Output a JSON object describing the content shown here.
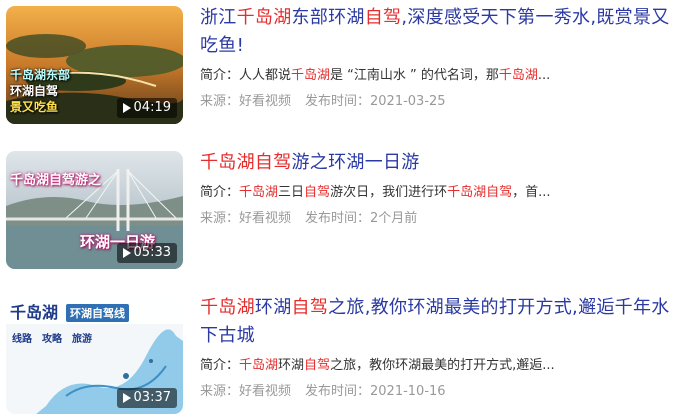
{
  "results": [
    {
      "title_parts": [
        {
          "text": "浙江",
          "hl": false
        },
        {
          "text": "千岛湖",
          "hl": true
        },
        {
          "text": "东部环湖",
          "hl": false
        },
        {
          "text": "自驾",
          "hl": true
        },
        {
          "text": ",深度感受天下第一秀水,既赏景又吃鱼!",
          "hl": false
        }
      ],
      "desc_parts": [
        {
          "text": "简介：人人都说",
          "hl": false
        },
        {
          "text": "千岛湖",
          "hl": true
        },
        {
          "text": "是 “江南山水 ” 的代名词，那",
          "hl": false
        },
        {
          "text": "千岛湖",
          "hl": true
        },
        {
          "text": "...",
          "hl": false
        }
      ],
      "source": "来源：好看视频",
      "time": "发布时间：2021-03-25",
      "duration": "04:19",
      "overlay": [
        "千岛湖东部",
        "环湖自驾",
        "景又吃鱼"
      ]
    },
    {
      "title_parts": [
        {
          "text": "千岛湖自驾",
          "hl": true
        },
        {
          "text": "游之环湖一日游",
          "hl": false
        }
      ],
      "desc_parts": [
        {
          "text": "简介：",
          "hl": false
        },
        {
          "text": "千岛湖",
          "hl": true
        },
        {
          "text": "三日",
          "hl": false
        },
        {
          "text": "自驾",
          "hl": true
        },
        {
          "text": "游次日，我们进行环",
          "hl": false
        },
        {
          "text": "千岛湖自驾",
          "hl": true
        },
        {
          "text": "，首...",
          "hl": false
        }
      ],
      "source": "来源：好看视频",
      "time": "发布时间：2个月前",
      "duration": "05:33",
      "overlay": [
        "千岛湖自驾游之",
        "环湖一日游"
      ]
    },
    {
      "title_parts": [
        {
          "text": "千岛湖",
          "hl": true
        },
        {
          "text": "环湖",
          "hl": false
        },
        {
          "text": "自驾",
          "hl": true
        },
        {
          "text": "之旅,教你环湖最美的打开方式,邂逅千年水下古城",
          "hl": false
        }
      ],
      "desc_parts": [
        {
          "text": "简介：",
          "hl": false
        },
        {
          "text": "千岛湖",
          "hl": true
        },
        {
          "text": "环湖",
          "hl": false
        },
        {
          "text": "自驾",
          "hl": true
        },
        {
          "text": "之旅，教你环湖最美的打开方式,邂逅...",
          "hl": false
        }
      ],
      "source": "来源：好看视频",
      "time": "发布时间：2021-10-16",
      "duration": "03:37",
      "overlay": [
        "千岛湖",
        "环湖自驾线",
        "线路",
        "攻略",
        "旅游"
      ]
    }
  ],
  "colors": {
    "title": "#2b3aa3",
    "highlight": "#e52d2d",
    "meta": "#999999"
  }
}
